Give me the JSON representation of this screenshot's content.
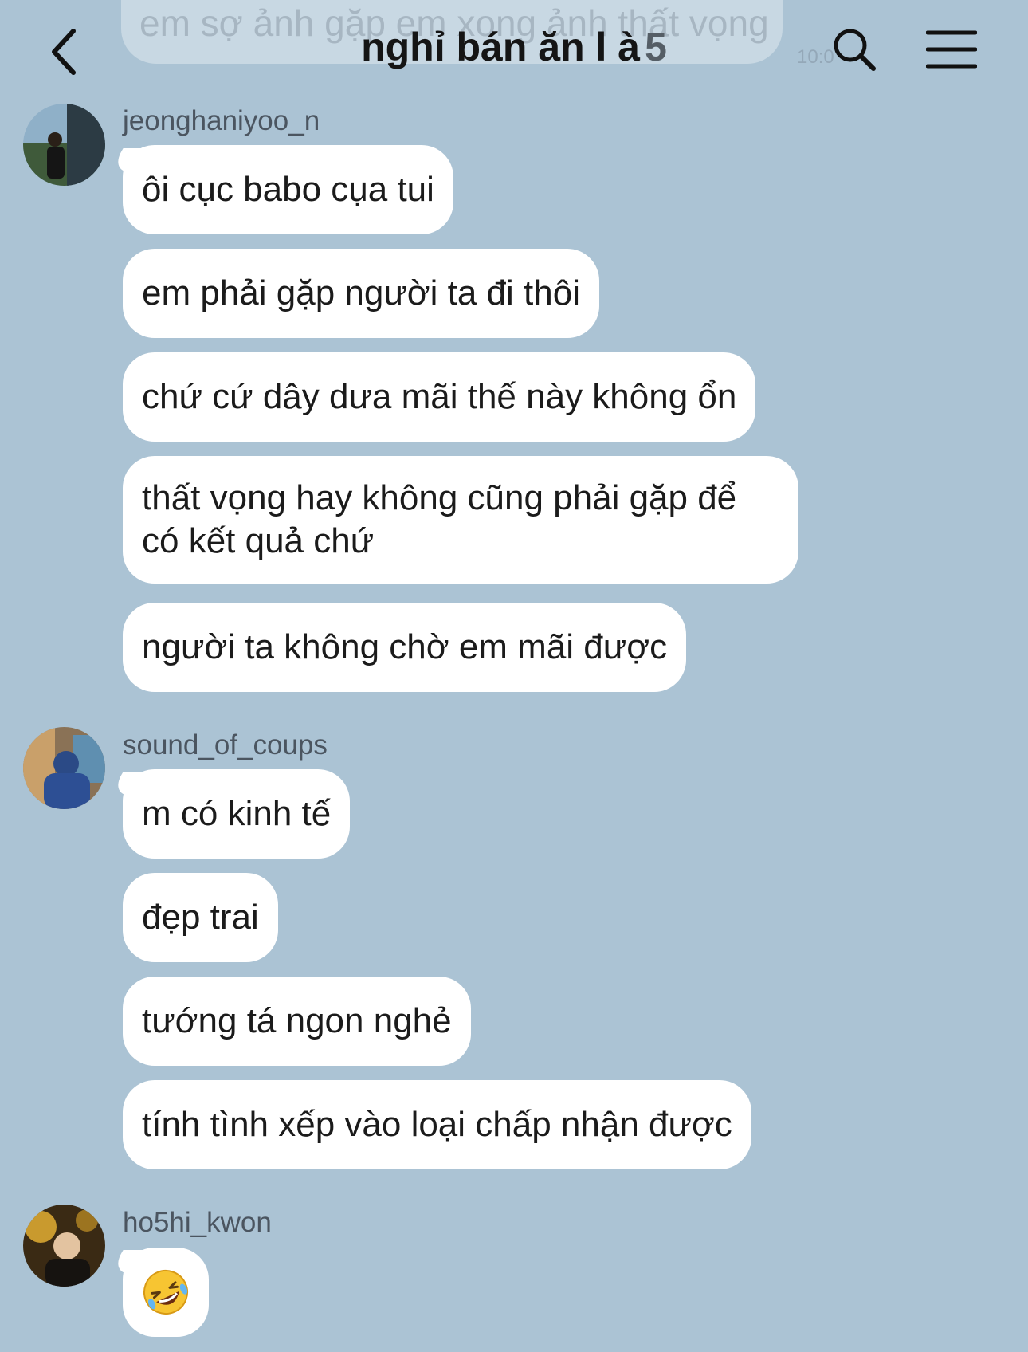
{
  "header": {
    "title": "nghỉ bán ăn l à",
    "member_count": "5",
    "back_icon": "chevron-left-icon",
    "search_icon": "search-icon",
    "menu_icon": "hamburger-menu-icon"
  },
  "previous_message": {
    "text": "em sợ ảnh gặp em xong ảnh thất vọng",
    "time": "10:0"
  },
  "groups": [
    {
      "username": "jeonghaniyoo_n",
      "messages": [
        "ôi cục babo cụa tui",
        "em phải gặp người ta đi thôi",
        "chứ cứ dây dưa mãi thế này không ổn",
        "thất vọng hay không cũng phải gặp để có kết quả chứ",
        "người ta không chờ em mãi được"
      ]
    },
    {
      "username": "sound_of_coups",
      "messages": [
        "m có kinh tế",
        "đẹp trai",
        "tướng tá ngon nghẻ",
        "tính tình xếp vào loại chấp nhận được"
      ]
    },
    {
      "username": "ho5hi_kwon",
      "messages": [
        "🤣"
      ]
    }
  ],
  "colors": {
    "background": "#abc3d4",
    "bubble": "#ffffff",
    "text": "#1b1b1b",
    "username": "#4b5560"
  }
}
